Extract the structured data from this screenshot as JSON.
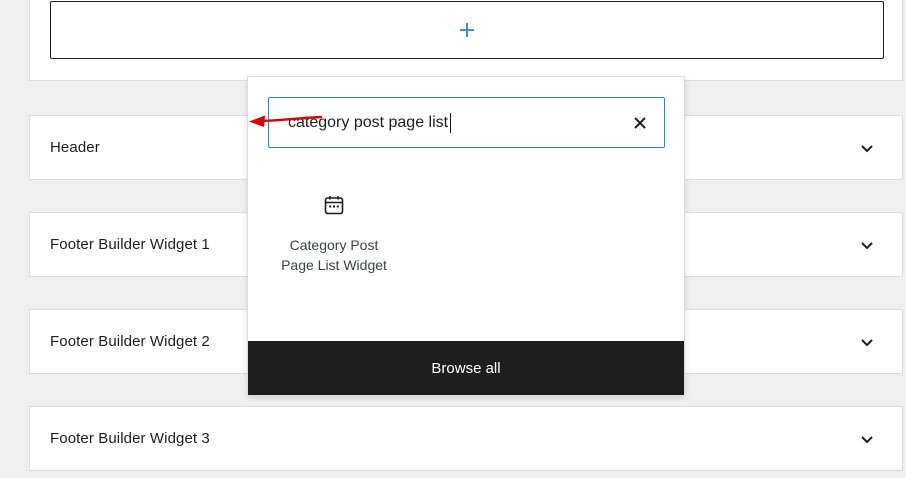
{
  "top_area": {
    "add_block_icon": "plus-icon"
  },
  "panels": [
    {
      "title": "Header",
      "icon": "chevron-down-icon"
    },
    {
      "title": "Footer Builder Widget 1",
      "icon": "chevron-down-icon"
    },
    {
      "title": "Footer Builder Widget 2",
      "icon": "chevron-down-icon"
    },
    {
      "title": "Footer Builder Widget 3",
      "icon": "chevron-down-icon"
    }
  ],
  "inserter": {
    "search_value": "category post page list",
    "clear_icon": "close-icon",
    "result": {
      "icon": "calendar-icon",
      "label": "Category Post Page List Widget"
    },
    "browse_all_label": "Browse all"
  },
  "colors": {
    "accent": "#3582c4",
    "annotation_arrow": "#e00000",
    "dark_bar": "#1e1e1e",
    "page_bg": "#f0f0f1"
  }
}
